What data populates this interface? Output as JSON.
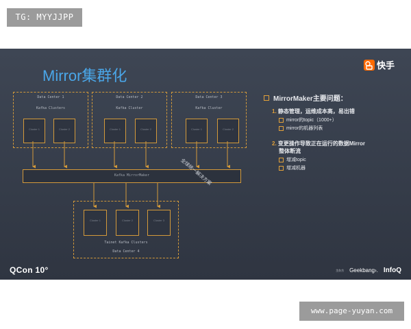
{
  "watermarks": {
    "top": "TG: MYYJJPP",
    "bottom": "www.page-yuyan.com"
  },
  "slide": {
    "title": "Mirror集群化",
    "brand": "快手",
    "diagram": {
      "data_centers": [
        {
          "label": "Data Center 1",
          "subtitle": "Kafka Clusters",
          "clusters": [
            "Cluster 1",
            "Cluster 2"
          ]
        },
        {
          "label": "Data Center 2",
          "subtitle": "Kafka Cluster",
          "clusters": [
            "Cluster 1",
            "Cluster 2"
          ]
        },
        {
          "label": "Data Center 3",
          "subtitle": "Kafka Cluster",
          "clusters": [
            "Cluster 1",
            "Cluster 2"
          ]
        },
        {
          "label": "Data Center 4",
          "subtitle": "Tainet Kafka Clusters",
          "clusters": [
            "Cluster 1",
            "Cluster 2",
            "Cluster 3"
          ]
        }
      ],
      "mirror_bar": "Kafka MirrorMaker",
      "overlay": "全球统一解决方案"
    },
    "panel": {
      "heading": "MirrorMaker主要问题：",
      "items": [
        {
          "num": "1.",
          "text": "静态管理，运维成本高，易出错",
          "subs": [
            "mirror的topic（1000+）",
            "mirror的机器列表"
          ]
        },
        {
          "num": "2.",
          "text": "变更操作导致正在运行的数据Mirror",
          "line2": "整体断流",
          "subs": [
            "增减topic",
            "增减机器"
          ]
        }
      ]
    },
    "footer": {
      "left": "QCon 10°",
      "right_small": "主办方",
      "geek": "Geekbang›.",
      "infoq": "InfoQ"
    }
  }
}
